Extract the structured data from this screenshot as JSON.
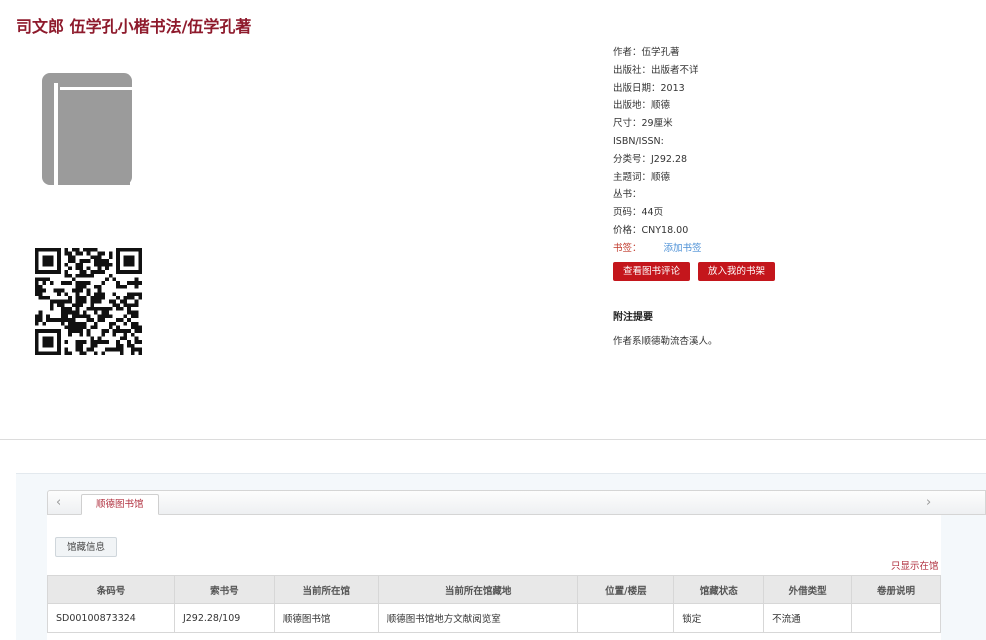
{
  "title": "司文郎 伍学孔小楷书法/伍学孔著",
  "meta": [
    "作者：伍学孔著",
    "出版社：出版者不详",
    "出版日期：2013",
    "出版地：顺德",
    "尺寸：29厘米",
    "ISBN/ISSN:",
    "分类号：J292.28",
    "主题词：顺德",
    "丛书：",
    "页码：44页",
    "价格：CNY18.00"
  ],
  "bookmark": {
    "label": "书签：",
    "add": "添加书签"
  },
  "buttons": {
    "review": "查看图书评论",
    "shelf": "放入我的书架"
  },
  "notes": {
    "heading": "附注提要",
    "text": "作者系顺德勒流杏溪人。"
  },
  "library_tab": "顺德图书馆",
  "subtab": "馆藏信息",
  "show_all": "只显示在馆",
  "icons": {
    "prev": "chevron-left-icon",
    "next": "chevron-right-icon",
    "book": "book-icon",
    "qr": "qr-code"
  },
  "colors": {
    "title": "#8e1a2c",
    "button": "#c4161c",
    "link": "#4a8fd6"
  },
  "table": {
    "headers": [
      "条码号",
      "索书号",
      "当前所在馆",
      "当前所在馆藏地",
      "位置/楼层",
      "馆藏状态",
      "外借类型",
      "卷册说明"
    ],
    "rows": [
      [
        "SD00100873324",
        "J292.28/109",
        "顺德图书馆",
        "顺德图书馆地方文献阅览室",
        "",
        "锁定",
        "不流通",
        ""
      ]
    ]
  }
}
